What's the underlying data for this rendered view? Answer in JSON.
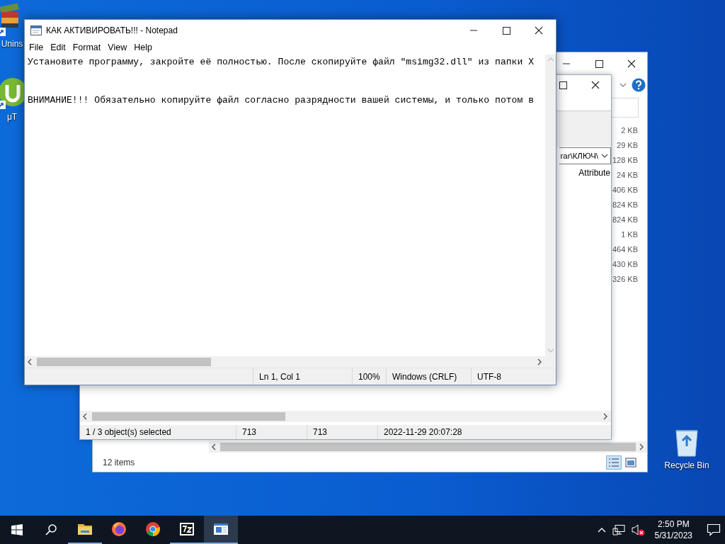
{
  "desktop_icons": [
    {
      "kind": "books",
      "label": "Unins"
    },
    {
      "kind": "torrent",
      "label": "μT"
    },
    {
      "kind": "recycle",
      "label": "Recycle Bin"
    }
  ],
  "explorer_window": {
    "file_sizes": [
      "2 KB",
      "29 KB",
      "128 KB",
      "24 KB",
      "406 KB",
      "824 KB",
      "824 KB",
      "1 KB",
      "464 KB",
      "430 KB",
      "326 KB"
    ],
    "status": "12 items"
  },
  "archiver_window": {
    "path": "rar\\КЛЮЧ\\",
    "column": "Attribute",
    "status_bar": [
      "1 / 3 object(s) selected",
      "713",
      "713",
      "2022-11-29 20:07:28"
    ]
  },
  "notepad": {
    "title": "КАК АКТИВИРОВАТЬ!!! - Notepad",
    "menu": [
      "File",
      "Edit",
      "Format",
      "View",
      "Help"
    ],
    "lines": [
      "Установите программу, закройте её полностью. После скопируйте файл \"msimg32.dll\" из папки X",
      "ВНИМАНИЕ!!! Обязательно копируйте файл согласно разрядности вашей системы, и только потом в"
    ],
    "status_bar": [
      "Ln 1, Col 1",
      "100%",
      "Windows (CRLF)",
      "UTF-8"
    ]
  },
  "taskbar": {
    "apps": [
      {
        "kind": "explorer",
        "running": true,
        "selected": false
      },
      {
        "kind": "firefox",
        "running": false,
        "selected": false
      },
      {
        "kind": "chrome",
        "running": false,
        "selected": false
      },
      {
        "kind": "sevenzip",
        "running": true,
        "selected": false
      },
      {
        "kind": "notepad",
        "running": true,
        "selected": true
      }
    ],
    "time": "2:50 PM",
    "date": "5/31/2023"
  }
}
